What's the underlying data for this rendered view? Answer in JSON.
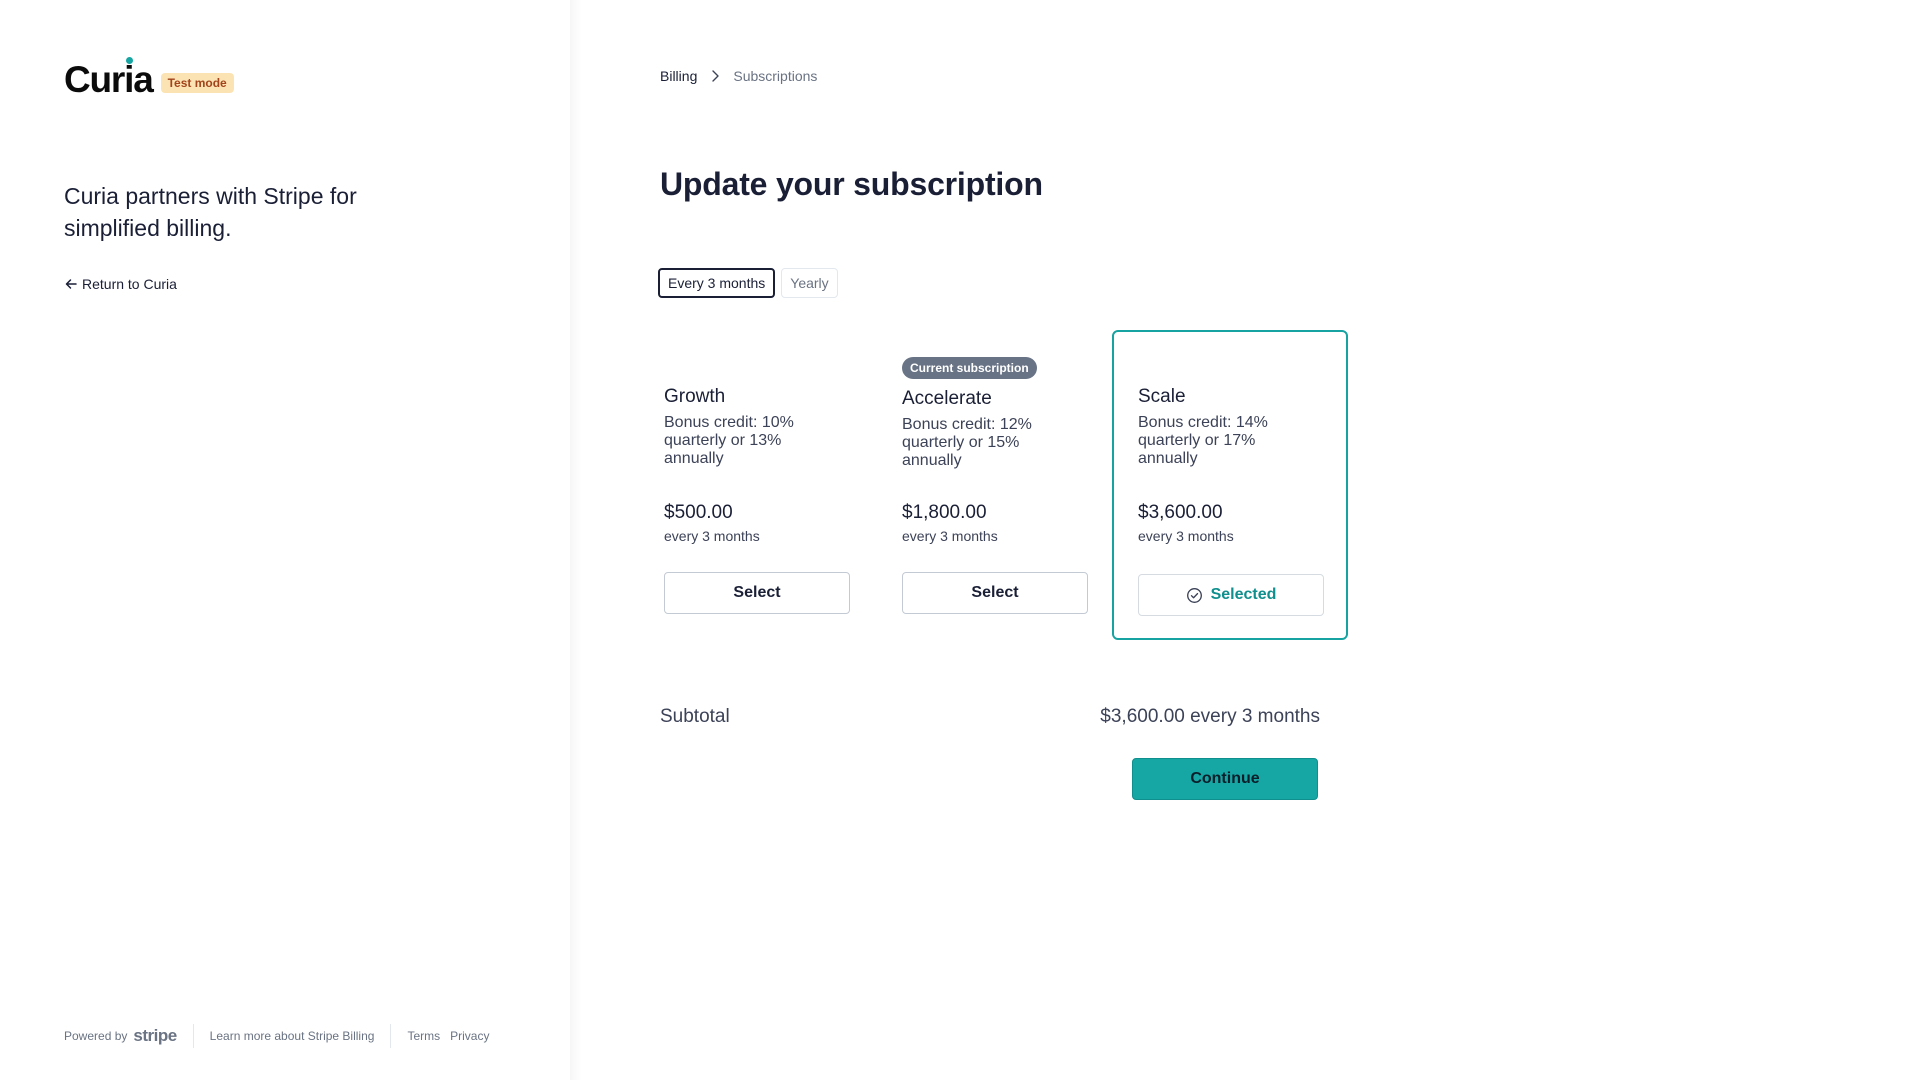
{
  "brand": {
    "name": "Curia",
    "test_badge": "Test mode",
    "accent_color": "#16a6a4"
  },
  "left": {
    "tagline": "Curia partners with Stripe for simplified billing.",
    "return_link": "Return to Curia",
    "footer": {
      "powered_by": "Powered by",
      "stripe_wordmark": "stripe",
      "learn_more": "Learn more about Stripe Billing",
      "terms": "Terms",
      "privacy": "Privacy"
    }
  },
  "breadcrumb": [
    "Billing",
    "Subscriptions"
  ],
  "page_title": "Update your subscription",
  "interval_toggle": {
    "options": [
      "Every 3 months",
      "Yearly"
    ],
    "selected": "Every 3 months"
  },
  "plans": [
    {
      "name": "Growth",
      "description": "Bonus credit: 10% quarterly or 13% annually",
      "price": "$500.00",
      "period": "every 3 months",
      "button": "Select",
      "current": false,
      "selected": false
    },
    {
      "name": "Accelerate",
      "description": "Bonus credit: 12% quarterly or 15% annually",
      "price": "$1,800.00",
      "period": "every 3 months",
      "button": "Select",
      "current": true,
      "current_badge": "Current subscription",
      "selected": false
    },
    {
      "name": "Scale",
      "description": "Bonus credit: 14% quarterly or 17% annually",
      "price": "$3,600.00",
      "period": "every 3 months",
      "button": "Selected",
      "current": false,
      "selected": true
    }
  ],
  "summary": {
    "subtotal_label": "Subtotal",
    "subtotal_value": "$3,600.00 every 3 months",
    "continue_button": "Continue"
  }
}
